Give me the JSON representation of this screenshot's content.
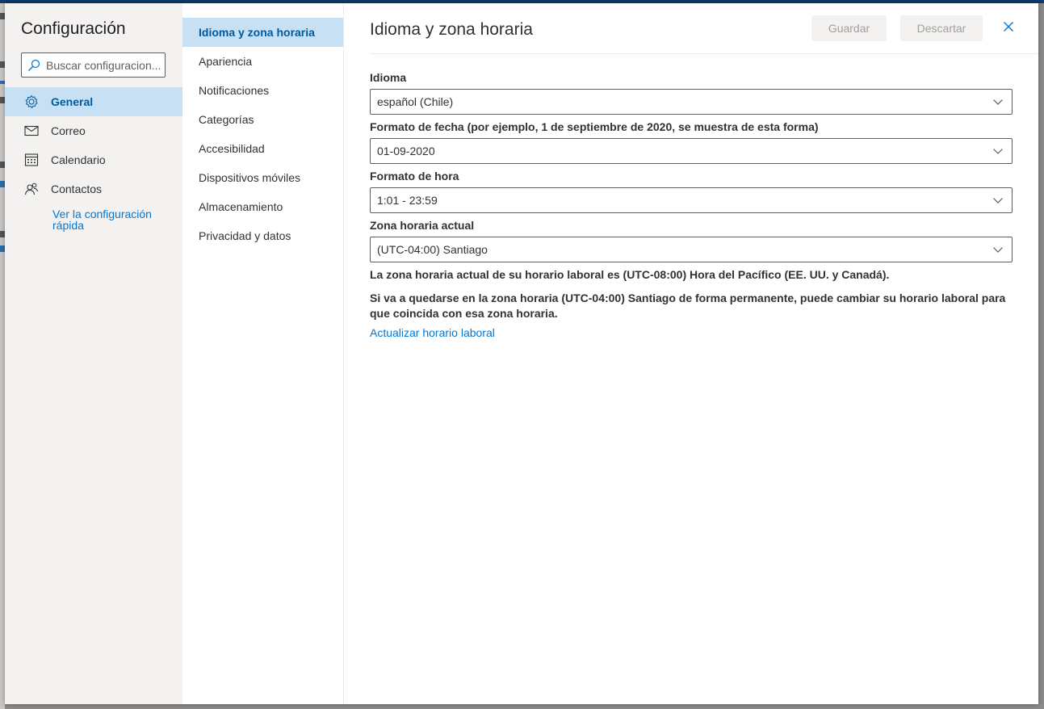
{
  "left_pane": {
    "title": "Configuración",
    "search": {
      "placeholder": "Buscar configuracion..."
    },
    "nav": [
      {
        "label": "General",
        "icon": "gear-icon",
        "selected": true
      },
      {
        "label": "Correo",
        "icon": "mail-icon",
        "selected": false
      },
      {
        "label": "Calendario",
        "icon": "calendar-icon",
        "selected": false
      },
      {
        "label": "Contactos",
        "icon": "people-icon",
        "selected": false
      }
    ],
    "quick_link": "Ver la configuración rápida"
  },
  "middle_pane": {
    "items": [
      {
        "label": "Idioma y zona horaria",
        "selected": true
      },
      {
        "label": "Apariencia"
      },
      {
        "label": "Notificaciones"
      },
      {
        "label": "Categorías"
      },
      {
        "label": "Accesibilidad"
      },
      {
        "label": "Dispositivos móviles"
      },
      {
        "label": "Almacenamiento"
      },
      {
        "label": "Privacidad y datos"
      }
    ]
  },
  "content": {
    "title": "Idioma y zona horaria",
    "save_label": "Guardar",
    "discard_label": "Descartar",
    "close_icon": "close-icon",
    "language": {
      "label": "Idioma",
      "value": "español (Chile)"
    },
    "date_format": {
      "label": "Formato de fecha (por ejemplo, 1 de septiembre de 2020, se muestra de esta forma)",
      "value": "01-09-2020"
    },
    "time_format": {
      "label": "Formato de hora",
      "value": "1:01 - 23:59"
    },
    "timezone": {
      "label": "Zona horaria actual",
      "value": "(UTC-04:00) Santiago"
    },
    "info_current": "La zona horaria actual de su horario laboral es (UTC-08:00) Hora del Pacífico (EE. UU. y Canadá).",
    "info_change": "Si va a quedarse en la zona horaria (UTC-04:00) Santiago de forma permanente, puede cambiar su horario laboral para que coincida con esa zona horaria.",
    "update_link": "Actualizar horario laboral"
  },
  "colors": {
    "accent": "#0078d4",
    "selected_bg": "#c7e0f4",
    "selected_text": "#005a9e",
    "left_bg": "#f3f2f1"
  }
}
